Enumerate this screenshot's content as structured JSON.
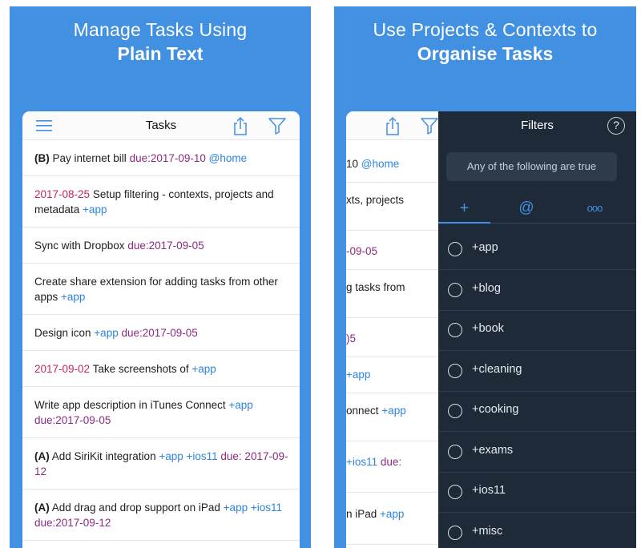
{
  "left": {
    "headline_line1": "Manage Tasks Using",
    "headline_line2": "Plain Text",
    "nav_title": "Tasks",
    "icons": [
      "menu-icon",
      "share-icon",
      "filter-icon"
    ],
    "tasks": [
      {
        "pri": "(B)",
        "text": " Pay internet bill ",
        "due": "due:2017-09-10",
        "tag": " @home"
      },
      {
        "date": "2017-08-25",
        "text": " Setup filtering - contexts, projects and metadata ",
        "tag": "+app"
      },
      {
        "text": "Sync with Dropbox ",
        "due": "due:2017-09-05"
      },
      {
        "text": "Create share extension for adding tasks from other apps ",
        "tag": "+app"
      },
      {
        "text": "Design icon ",
        "tag": "+app",
        "due": " due:2017-09-05"
      },
      {
        "date": "2017-09-02",
        "text": " Take screenshots of ",
        "tag": "+app"
      },
      {
        "text": "Write app description in iTunes Connect ",
        "tag": "+app",
        "due": " due:2017-09-05"
      },
      {
        "pri": "(A)",
        "text": " Add SiriKit integration ",
        "tag": "+app +ios11",
        "due": " due: 2017-09-12"
      },
      {
        "pri": "(A)",
        "text": " Add drag and drop support on iPad ",
        "tag": "+app +ios11",
        "due": " due:2017-09-12"
      }
    ]
  },
  "right": {
    "headline_line1": "Use Projects & Contexts to",
    "headline_line2": "Organise Tasks",
    "back_fragments": [
      {
        "text": "10 ",
        "tag": "@home"
      },
      {
        "text": "xts, projects"
      },
      {
        "due": "-09-05"
      },
      {
        "text": "g tasks from"
      },
      {
        "due": ")5"
      },
      {
        "tag": "+app"
      },
      {
        "text": "onnect ",
        "tag": "+app"
      },
      {
        "tag": "+ios11 ",
        "due": "due:"
      },
      {
        "text": "n iPad ",
        "tag": "+app"
      }
    ],
    "filters_title": "Filters",
    "help_label": "?",
    "mode_label": "Any of the following are true",
    "tabs": [
      "+",
      "@",
      "ooo"
    ],
    "filter_items": [
      "+app",
      "+blog",
      "+book",
      "+cleaning",
      "+cooking",
      "+exams",
      "+ios11",
      "+misc"
    ]
  },
  "colors": {
    "background_blue": "#4290e1",
    "due_purple": "#8b2a82",
    "date_red": "#c4265a",
    "tag_blue": "#2f84de",
    "filters_bg": "#1e2a38"
  }
}
